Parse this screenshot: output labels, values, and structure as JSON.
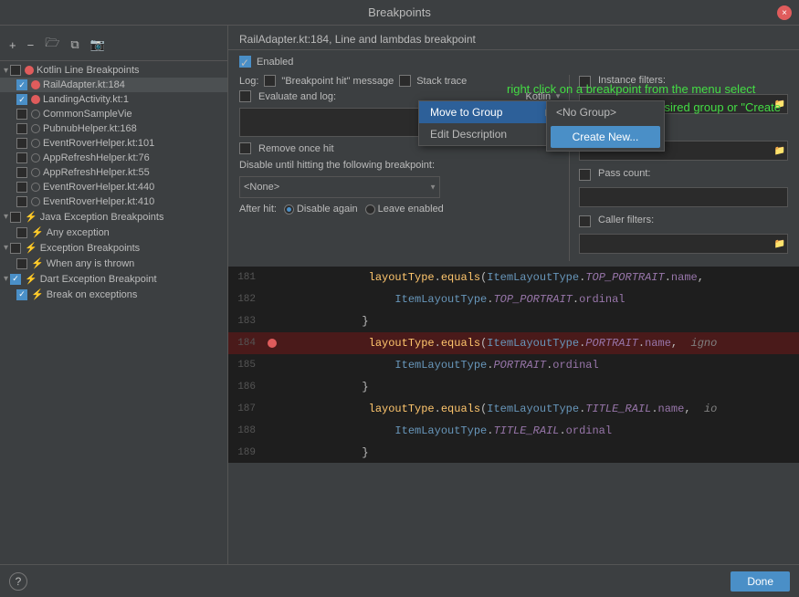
{
  "window": {
    "title": "Breakpoints",
    "close_label": "×"
  },
  "header": {
    "breadcrumb": "RailAdapter.kt:184, Line and lambdas breakpoint"
  },
  "left_panel": {
    "toolbar": {
      "add": "+",
      "remove": "−",
      "folder": "📁",
      "copy": "⊞",
      "camera": "📷"
    },
    "sections": [
      {
        "label": "Kotlin Line Breakpoints",
        "items": [
          {
            "name": "RailAdapter.kt:184",
            "checked": true,
            "has_dot": true
          },
          {
            "name": "LandingActivity.kt:1",
            "checked": true,
            "has_dot": true
          },
          {
            "name": "CommonSampleVie",
            "checked": false,
            "has_dot": false
          },
          {
            "name": "PubnubHelper.kt:168",
            "checked": false,
            "has_dot": false
          },
          {
            "name": "EventRoverHelper.kt:101",
            "checked": false,
            "has_dot": false
          },
          {
            "name": "AppRefreshHelper.kt:76",
            "checked": false,
            "has_dot": false
          },
          {
            "name": "AppRefreshHelper.kt:55",
            "checked": false,
            "has_dot": false
          },
          {
            "name": "EventRoverHelper.kt:440",
            "checked": false,
            "has_dot": false
          },
          {
            "name": "EventRoverHelper.kt:410",
            "checked": false,
            "has_dot": false
          }
        ]
      },
      {
        "label": "Java Exception Breakpoints",
        "items": [
          {
            "name": "Any exception",
            "checked": false,
            "has_bolt": true
          }
        ]
      },
      {
        "label": "Exception Breakpoints",
        "items": [
          {
            "name": "When any is thrown",
            "checked": false,
            "has_bolt": true
          }
        ]
      },
      {
        "label": "Dart Exception Breakpoint",
        "items": [
          {
            "name": "Break on exceptions",
            "checked": true,
            "has_bolt": true
          }
        ]
      }
    ]
  },
  "right_panel": {
    "enabled_label": "Enabled",
    "log_label": "Log:",
    "breakpoint_hit_label": "\"Breakpoint hit\" message",
    "stack_trace_label": "Stack trace",
    "instance_filters_label": "Instance filters:",
    "evaluate_label": "Evaluate and log:",
    "kotlin_label": "Kotlin",
    "class_filters_label": "Class filters:",
    "remove_once_label": "Remove once hit",
    "disable_until_label": "Disable until hitting the following breakpoint:",
    "none_option": "<None>",
    "pass_count_label": "Pass count:",
    "after_hit_label": "After hit:",
    "disable_again_label": "Disable again",
    "leave_enabled_label": "Leave enabled",
    "caller_filters_label": "Caller filters:"
  },
  "context_menu": {
    "items": [
      {
        "label": "Move to Group",
        "has_arrow": true,
        "active": true
      },
      {
        "label": "Edit Description",
        "has_arrow": false,
        "active": false
      }
    ]
  },
  "submenu": {
    "items": [
      {
        "label": "<No Group>",
        "active": false
      },
      {
        "label": "Create New...",
        "is_button": true
      }
    ]
  },
  "annotation": {
    "text": "right click on a breakpoint from the menu select \"Move to Group\" select the desired group or \"Create New...\""
  },
  "code": {
    "lines": [
      {
        "num": "181",
        "has_bp": false,
        "content": "layoutType.equals(ItemLayoutType.TOP_PORTRAIT.name,"
      },
      {
        "num": "182",
        "has_bp": false,
        "content": "    ItemLayoutType.TOP_PORTRAIT.ordinal"
      },
      {
        "num": "183",
        "has_bp": false,
        "content": "}"
      },
      {
        "num": "184",
        "has_bp": true,
        "content": "layoutType.equals(ItemLayoutType.PORTRAIT.name,  igno"
      },
      {
        "num": "185",
        "has_bp": false,
        "content": "    ItemLayoutType.PORTRAIT.ordinal"
      },
      {
        "num": "186",
        "has_bp": false,
        "content": "}"
      },
      {
        "num": "187",
        "has_bp": false,
        "content": "layoutType.equals(ItemLayoutType.TITLE_RAIL.name,  io"
      },
      {
        "num": "188",
        "has_bp": false,
        "content": "    ItemLayoutType.TITLE_RAIL.ordinal"
      },
      {
        "num": "189",
        "has_bp": false,
        "content": "}"
      }
    ]
  },
  "bottom_bar": {
    "help_label": "?",
    "done_label": "Done"
  }
}
